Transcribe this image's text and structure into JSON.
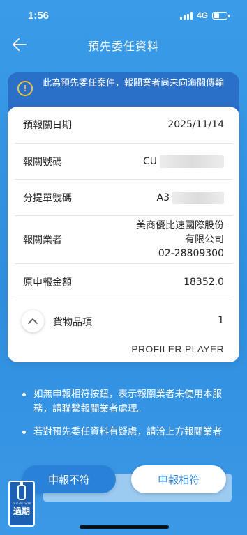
{
  "status_bar": {
    "time": "1:56",
    "network": "4G"
  },
  "header": {
    "title": "預先委任資料"
  },
  "notice": {
    "text": "此為預先委任案件，報關業者尚未向海關傳輸"
  },
  "details": {
    "declaration_date_label": "預報關日期",
    "declaration_date_value": "2025/11/14",
    "declaration_no_label": "報關號碼",
    "declaration_no_value": "CU",
    "bill_no_label": "分提單號碼",
    "bill_no_value": "A3",
    "broker_label": "報關業者",
    "broker_name_line1": "美商優比速國際股份",
    "broker_name_line2": "有限公司",
    "broker_phone": "02-28809300",
    "amount_label": "原申報金額",
    "amount_value": "18352.0",
    "goods_label": "貨物品項",
    "goods_count": "1",
    "goods_item": "PROFILER PLAYER"
  },
  "notes": [
    "如無申報相符按鈕，表示報關業者未使用本服務，請聯繫報關業者處理。",
    "若對預先委任資料有疑慮，請洽上方報關業者"
  ],
  "buttons": {
    "reject": "申報不符",
    "accept": "申報相符"
  },
  "badge": {
    "small_text": "OUT OF DATE",
    "text": "過期"
  },
  "colors": {
    "background": "#3a9ce8",
    "notice_bg": "#2a6fc8",
    "warning": "#f2c43c",
    "accent": "#2a82d8"
  },
  "icons": {
    "back": "arrow-left-icon",
    "warning": "exclamation-circle-icon",
    "toggle": "chevron-up-icon"
  }
}
